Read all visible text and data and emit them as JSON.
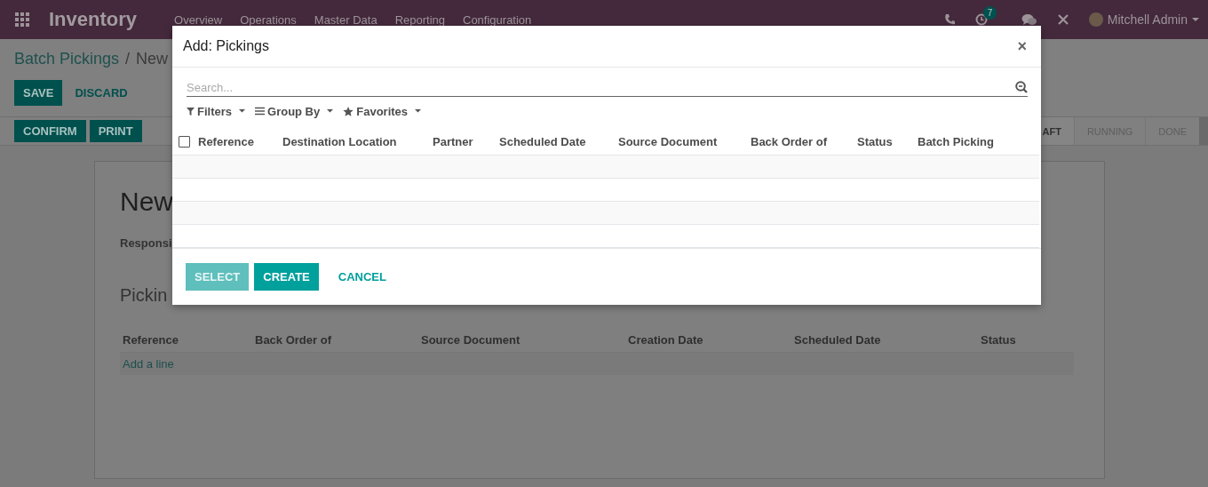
{
  "navbar": {
    "app_name": "Inventory",
    "menu": [
      "Overview",
      "Operations",
      "Master Data",
      "Reporting",
      "Configuration"
    ],
    "activity_count": "7",
    "user": "Mitchell Admin"
  },
  "breadcrumb": {
    "parent": "Batch Pickings",
    "separator": "/",
    "current": "New"
  },
  "form_buttons": [
    {
      "label": "SAVE",
      "kind": "primary"
    },
    {
      "label": "DISCARD",
      "kind": "link"
    }
  ],
  "header_buttons": [
    "CONFIRM",
    "PRINT"
  ],
  "status_steps": [
    {
      "label": "AFT",
      "selected": true
    },
    {
      "label": "RUNNING",
      "selected": false
    },
    {
      "label": "DONE",
      "selected": false
    }
  ],
  "form": {
    "title": "New",
    "field_label": "Responsi",
    "section_title": "Pickin",
    "table": {
      "columns": [
        "Reference",
        "Back Order of",
        "Source Document",
        "Creation Date",
        "Scheduled Date",
        "Status"
      ],
      "add_line": "Add a line"
    }
  },
  "dialog": {
    "title": "Add: Pickings",
    "close": "×",
    "search": {
      "placeholder": "Search..."
    },
    "search_options": [
      "Filters",
      "Group By",
      "Favorites"
    ],
    "table": {
      "select_all_checked": false,
      "columns": [
        "Reference",
        "Destination Location",
        "Partner",
        "Scheduled Date",
        "Source Document",
        "Back Order of",
        "Status",
        "Batch Picking"
      ]
    },
    "buttons": [
      {
        "label": "SELECT",
        "kind": "primary",
        "disabled": true
      },
      {
        "label": "CREATE",
        "kind": "primary",
        "disabled": false
      },
      {
        "label": "CANCEL",
        "kind": "link",
        "disabled": false
      }
    ]
  }
}
